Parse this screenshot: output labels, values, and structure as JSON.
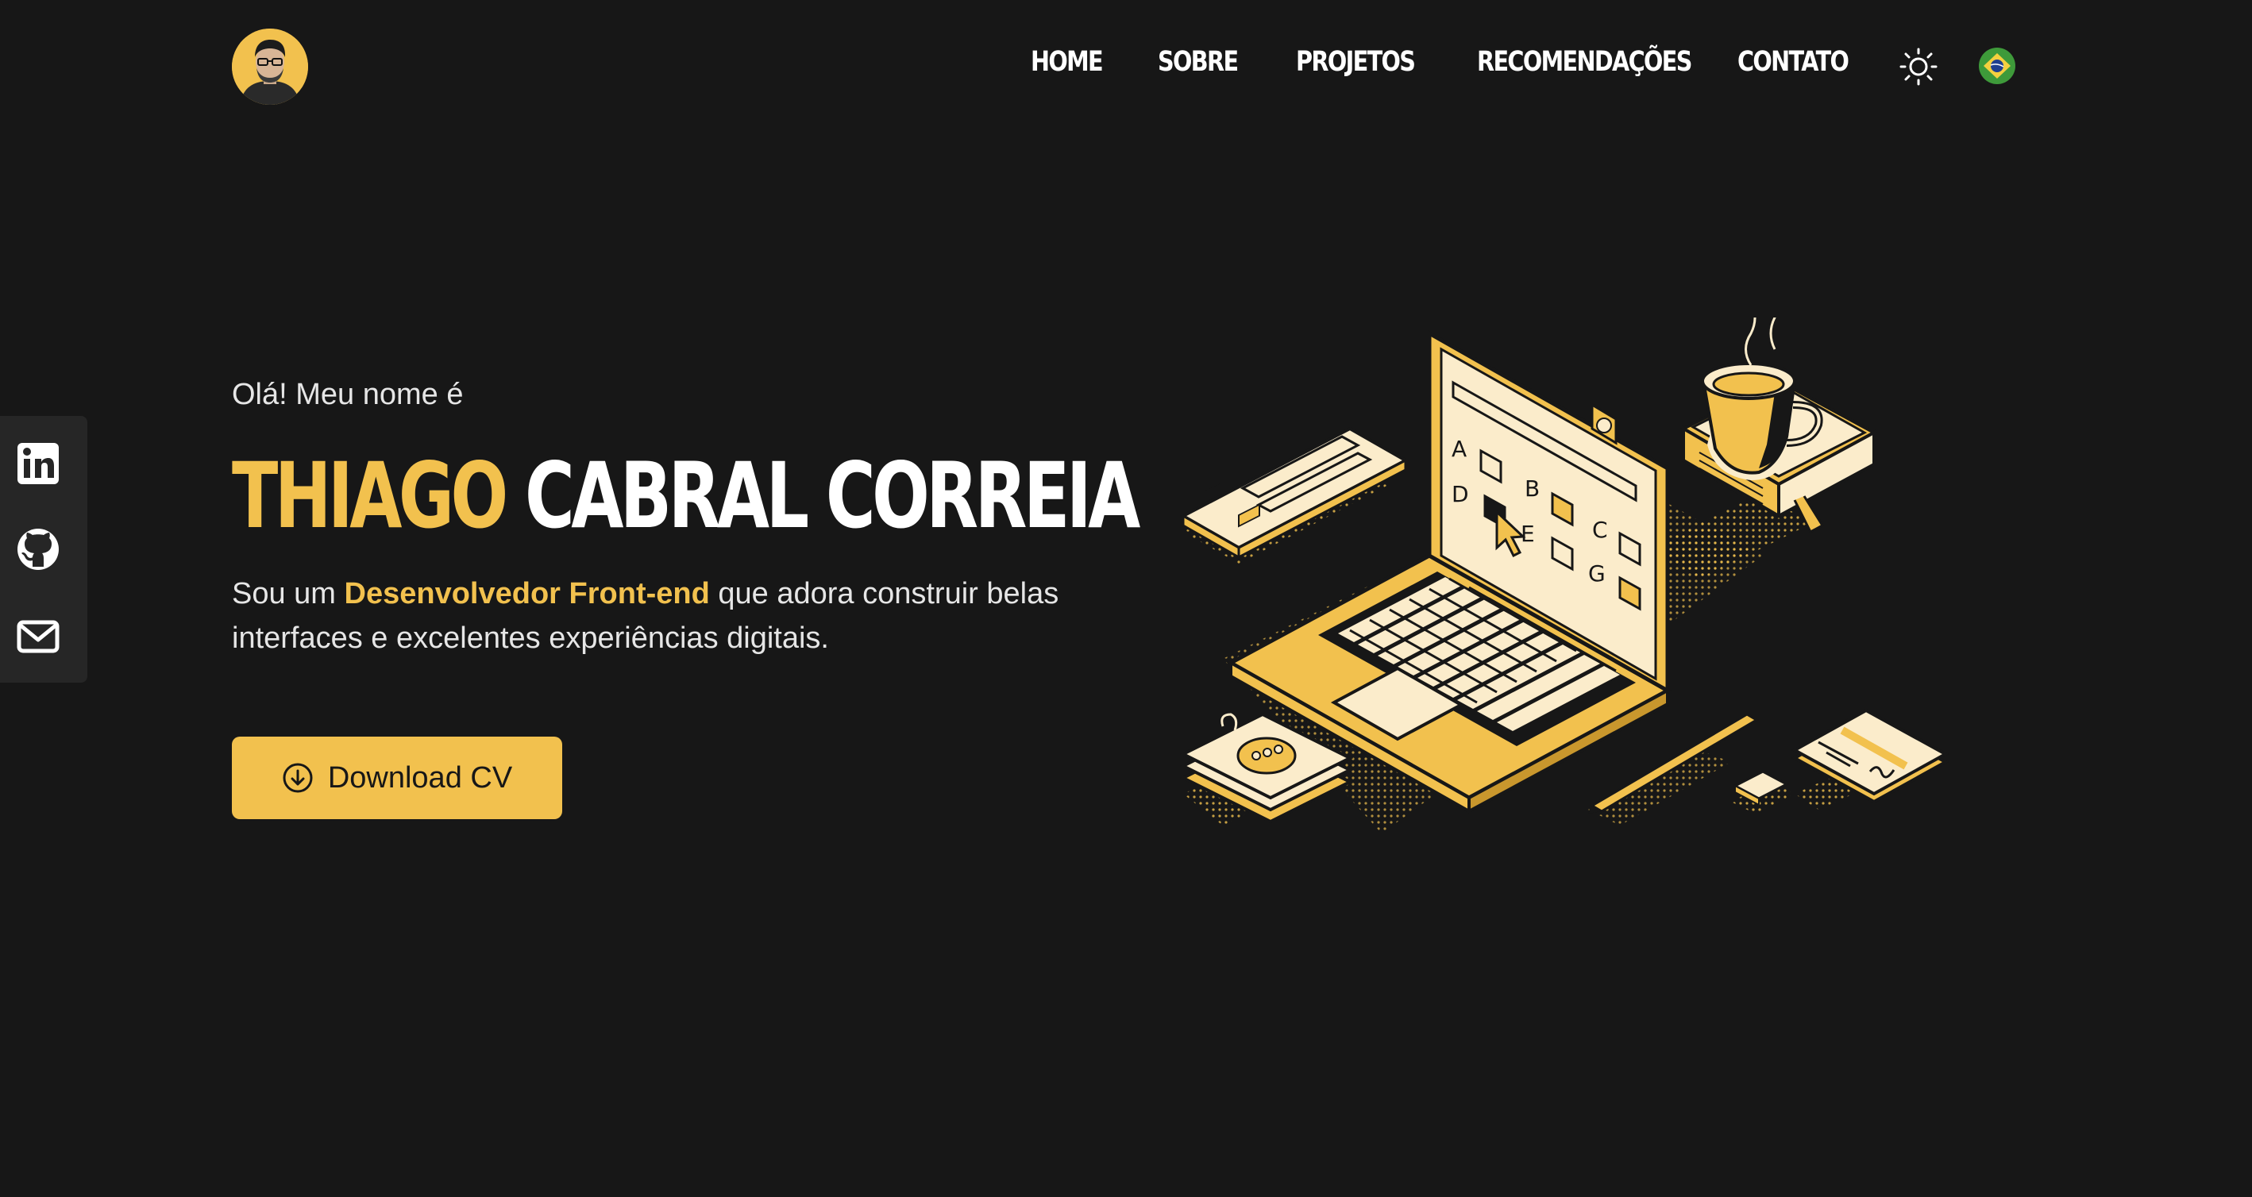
{
  "header": {
    "avatar_icon": "profile-photo",
    "nav": {
      "home": "HOME",
      "about": "SOBRE",
      "projects": "PROJETOS",
      "recommendations": "RECOMENDAÇÕES",
      "contact": "CONTATO"
    },
    "theme_icon": "sun-icon",
    "language_icon": "brazil-flag-icon"
  },
  "social": [
    "linkedin-icon",
    "github-icon",
    "mail-icon"
  ],
  "hero": {
    "greeting": "Olá! Meu nome é",
    "first_name": "THIAGO",
    "last_name": "CABRAL CORREIA",
    "tagline_before": "Sou um",
    "tagline_highlight": "Desenvolvedor Front-end",
    "tagline_after": "que adora construir belas interfaces e excelentes experiências digitais.",
    "download_label": "Download CV",
    "download_icon": "arrow-down-circle-icon"
  },
  "illustration": {
    "quiz_letters": [
      "A",
      "B",
      "C",
      "D",
      "E",
      "G"
    ]
  },
  "colors": {
    "background": "#171717",
    "accent": "#f2c14e",
    "sidebar": "#262626",
    "text": "#ffffff"
  }
}
